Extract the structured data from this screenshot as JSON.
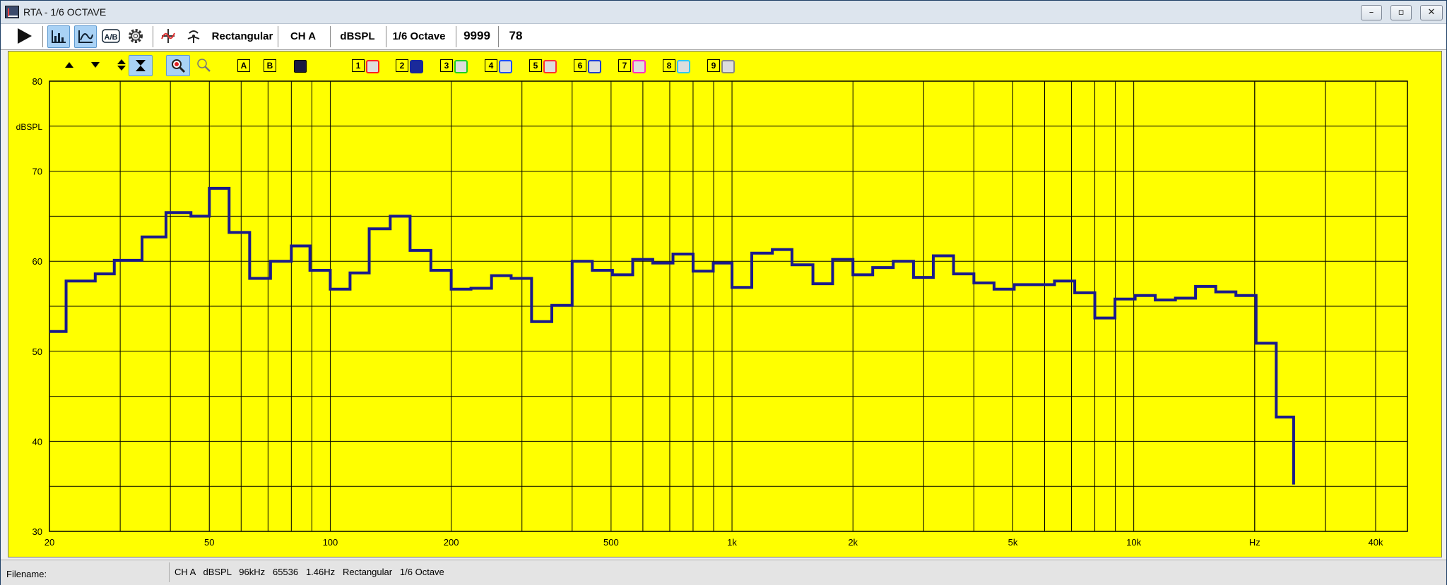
{
  "window": {
    "title": "RTA - 1/6 OCTAVE"
  },
  "toolbar": {
    "window_type": "Rectangular",
    "channel": "CH A",
    "units": "dBSPL",
    "resolution": "1/6 Octave",
    "averages": "9999",
    "count": "78"
  },
  "plot_toolbar": {
    "overlay_a": "A",
    "overlay_b": "B",
    "memories": [
      {
        "label": "1",
        "color": "#ff2020"
      },
      {
        "label": "2",
        "color": "#1a2a9a"
      },
      {
        "label": "3",
        "color": "#20d020"
      },
      {
        "label": "4",
        "color": "#2050ff"
      },
      {
        "label": "5",
        "color": "#ff3030"
      },
      {
        "label": "6",
        "color": "#2040d0"
      },
      {
        "label": "7",
        "color": "#ff30c0"
      },
      {
        "label": "8",
        "color": "#30c8f0"
      },
      {
        "label": "9",
        "color": "#888888"
      }
    ]
  },
  "chart_data": {
    "type": "line",
    "ylabel": "dBSPL",
    "xlabel": "Hz",
    "xscale": "log",
    "xlim": [
      20,
      48000
    ],
    "ylim": [
      30,
      80
    ],
    "x_ticks": [
      {
        "v": 20,
        "label": "20"
      },
      {
        "v": 50,
        "label": "50"
      },
      {
        "v": 100,
        "label": "100"
      },
      {
        "v": 200,
        "label": "200"
      },
      {
        "v": 500,
        "label": "500"
      },
      {
        "v": 1000,
        "label": "1k"
      },
      {
        "v": 2000,
        "label": "2k"
      },
      {
        "v": 5000,
        "label": "5k"
      },
      {
        "v": 10000,
        "label": "10k"
      },
      {
        "v": 20000,
        "label": "Hz"
      },
      {
        "v": 40000,
        "label": "40k"
      }
    ],
    "y_ticks": [
      {
        "v": 30,
        "label": "30"
      },
      {
        "v": 40,
        "label": "40"
      },
      {
        "v": 50,
        "label": "50"
      },
      {
        "v": 60,
        "label": "60"
      },
      {
        "v": 70,
        "label": "70"
      },
      {
        "v": 80,
        "label": "80"
      }
    ],
    "line_color": "#1a1a8c",
    "background": "#ffff00",
    "grid": true,
    "series": [
      {
        "name": "",
        "x": [
          20,
          22,
          26,
          29,
          34,
          39,
          45,
          50,
          56,
          63,
          71,
          80,
          89,
          100,
          112,
          125,
          141,
          158,
          178,
          200,
          224,
          252,
          282,
          317,
          356,
          400,
          449,
          504,
          566,
          635,
          713,
          800,
          898,
          1000,
          1120,
          1260,
          1410,
          1590,
          1780,
          2000,
          2240,
          2520,
          2830,
          3170,
          3560,
          4000,
          4490,
          5040,
          5660,
          6350,
          7130,
          8000,
          8980,
          10080,
          11310,
          12700,
          14250,
          16000,
          17960,
          20160,
          22630,
          25000
        ],
        "y": [
          52.2,
          57.8,
          58.6,
          60.1,
          62.7,
          65.4,
          65.0,
          68.1,
          63.2,
          58.1,
          60.0,
          61.7,
          59.0,
          56.9,
          58.7,
          63.6,
          65.0,
          61.2,
          59.0,
          56.9,
          57.0,
          58.4,
          58.1,
          53.3,
          55.1,
          60.0,
          59.0,
          58.5,
          60.2,
          59.8,
          60.8,
          58.9,
          59.8,
          57.1,
          60.9,
          61.3,
          59.6,
          57.5,
          60.2,
          58.5,
          59.3,
          60.0,
          58.2,
          60.6,
          58.6,
          57.6,
          56.9,
          57.4,
          57.4,
          57.8,
          56.5,
          53.7,
          55.8,
          56.2,
          55.7,
          55.9,
          57.2,
          56.6,
          56.2,
          50.9,
          42.7,
          35.2
        ]
      }
    ]
  },
  "statusbar": {
    "filename_label": "Filename:",
    "info": "CH A   dBSPL   96kHz   65536   1.46Hz   Rectangular   1/6 Octave"
  }
}
